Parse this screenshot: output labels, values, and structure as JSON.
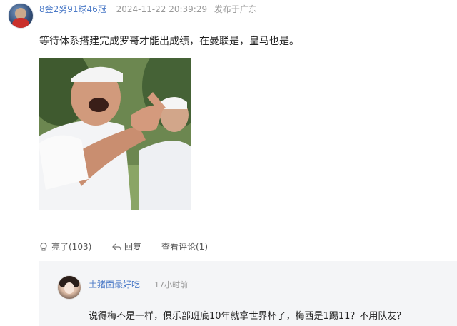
{
  "post": {
    "author": {
      "name": "8金2努91球46冠",
      "timestamp": "2024-11-22 20:39:29",
      "location": "发布于广东"
    },
    "text": "等待体系搭建完成罗哥才能出成绩，在曼联是，皇马也是。",
    "actions": {
      "like": "亮了(103)",
      "reply": "回复",
      "view_comments": "查看评论(1)"
    }
  },
  "reply": {
    "author": "土猪面最好吃",
    "time": "17小时前",
    "text": "说得梅不是一样，俱乐部班底10年就拿世界杯了，梅西是1踢11？不用队友？"
  },
  "colors": {
    "link_blue": "#4a79c7",
    "muted": "#999999",
    "reply_bg": "#f4f5f7"
  }
}
